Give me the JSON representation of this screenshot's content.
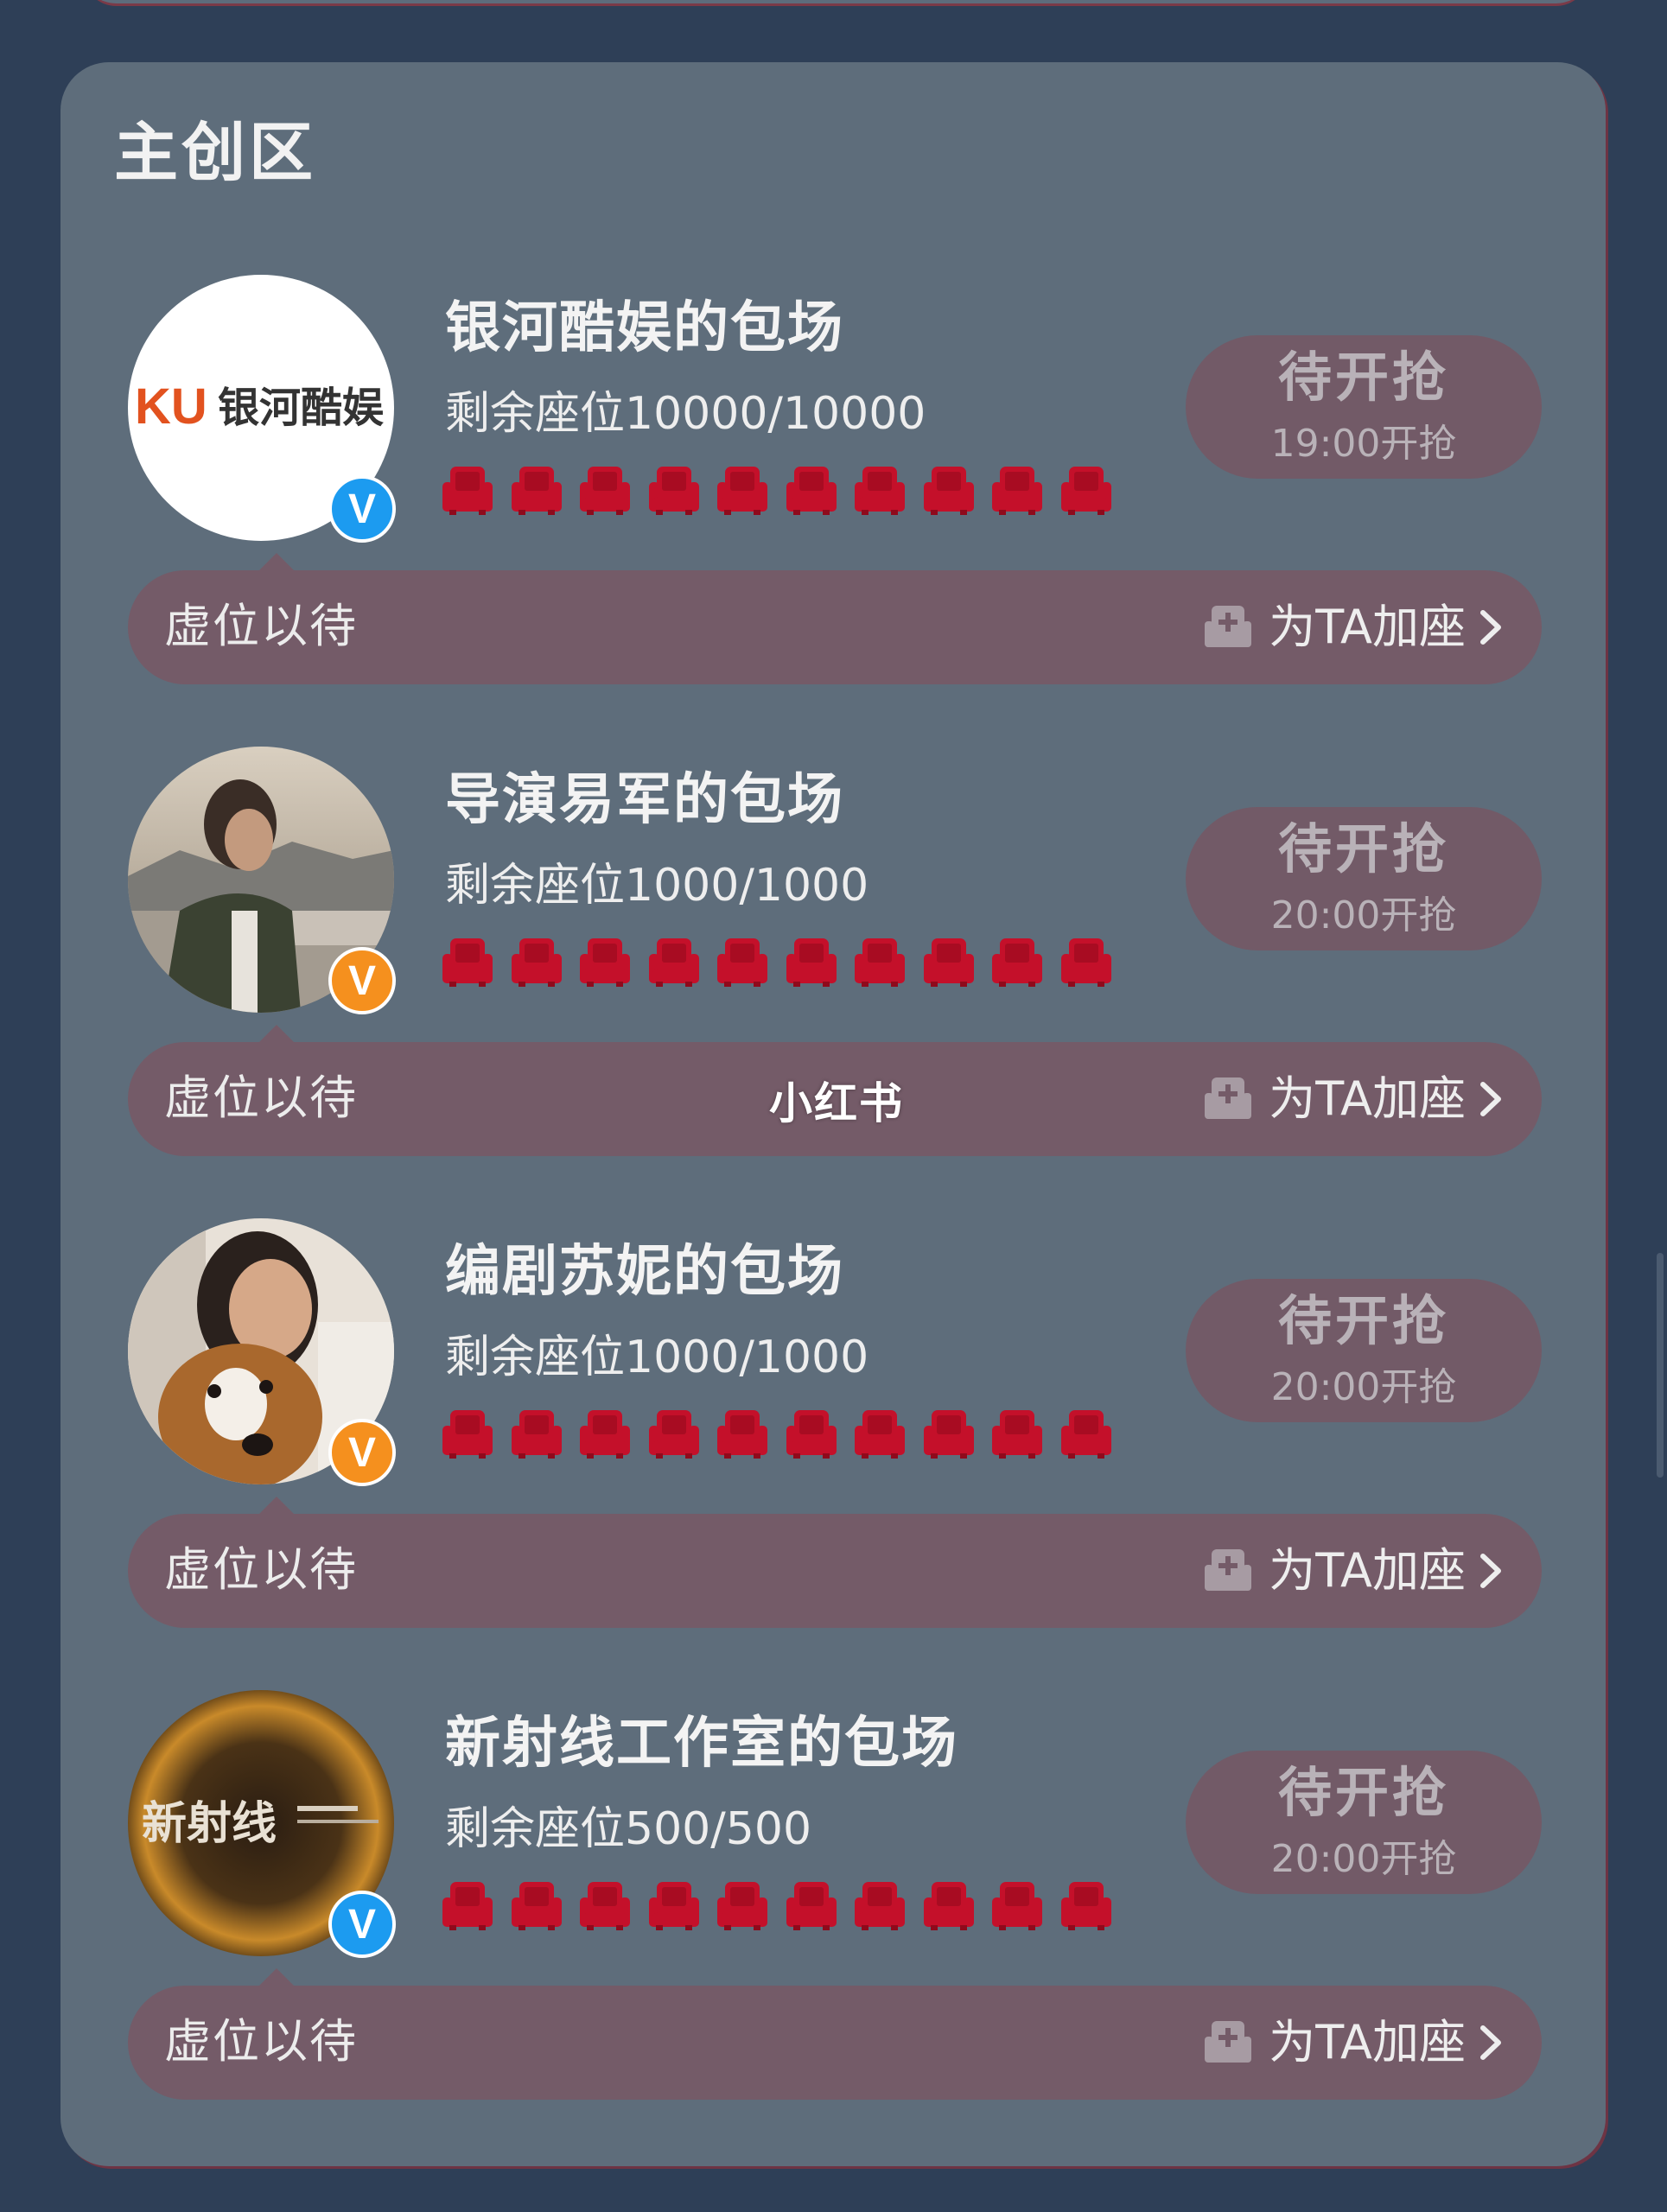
{
  "section": {
    "title": "主创区"
  },
  "cards": [
    {
      "title": "银河酷娱的包场",
      "seats_text": "剩余座位10000/10000",
      "seats_remaining": 10000,
      "seats_total": 10000,
      "grab_status": "待开抢",
      "grab_time": "19:00开抢",
      "bubble_label": "虚位以待",
      "add_seat_label": "为TA加座",
      "verified_color": "blue",
      "avatar_text_left": "KU",
      "avatar_text_right": "银河酷娱"
    },
    {
      "title": "导演易军的包场",
      "seats_text": "剩余座位1000/1000",
      "seats_remaining": 1000,
      "seats_total": 1000,
      "grab_status": "待开抢",
      "grab_time": "20:00开抢",
      "bubble_label": "虚位以待",
      "add_seat_label": "为TA加座",
      "verified_color": "orange"
    },
    {
      "title": "编剧苏妮的包场",
      "seats_text": "剩余座位1000/1000",
      "seats_remaining": 1000,
      "seats_total": 1000,
      "grab_status": "待开抢",
      "grab_time": "20:00开抢",
      "bubble_label": "虚位以待",
      "add_seat_label": "为TA加座",
      "verified_color": "orange"
    },
    {
      "title": "新射线工作室的包场",
      "seats_text": "剩余座位500/500",
      "seats_remaining": 500,
      "seats_total": 500,
      "grab_status": "待开抢",
      "grab_time": "20:00开抢",
      "bubble_label": "虚位以待",
      "add_seat_label": "为TA加座",
      "verified_color": "blue",
      "avatar_text": "新射线"
    }
  ],
  "watermark": "小红书",
  "colors": {
    "background": "#2e3f57",
    "panel": "#5e6d7b",
    "seat_red": "#c4102a",
    "grab_button": "#725a67",
    "bubble": "#745b68",
    "verified_blue": "#1c9bf0",
    "verified_orange": "#f5901e"
  },
  "icons": {
    "seat": "armchair-icon",
    "add_seat": "add-seat-icon",
    "chevron": "chevron-right-icon",
    "verified": "verified-v-icon"
  }
}
